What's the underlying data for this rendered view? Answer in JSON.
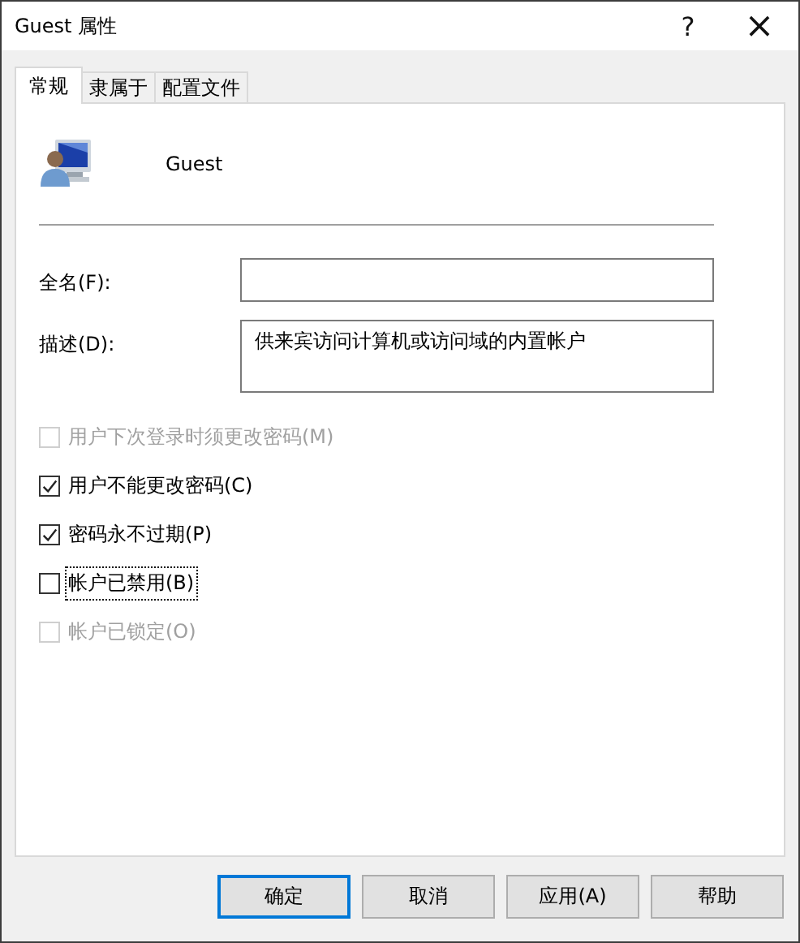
{
  "window": {
    "title": "Guest 属性",
    "help": "?",
    "close": "×"
  },
  "tabs": [
    {
      "label": "常规",
      "selected": true
    },
    {
      "label": "隶属于",
      "selected": false
    },
    {
      "label": "配置文件",
      "selected": false
    }
  ],
  "user": {
    "name": "Guest"
  },
  "fields": [
    {
      "label": "全名(F):",
      "kind": "line"
    },
    {
      "label": "描述(D):",
      "value": "供来宾访问计算机或访问域的内置帐户",
      "kind": "area"
    }
  ],
  "options": [
    {
      "label": "用户下次登录时须更改密码(M)",
      "checked": false,
      "disabled": true,
      "focused": false
    },
    {
      "label": "用户不能更改密码(C)",
      "checked": true,
      "disabled": false,
      "focused": false
    },
    {
      "label": "密码永不过期(P)",
      "checked": true,
      "disabled": false,
      "focused": false
    },
    {
      "label": "帐户已禁用(B)",
      "checked": false,
      "disabled": false,
      "focused": true
    },
    {
      "label": "帐户已锁定(O)",
      "checked": false,
      "disabled": true,
      "focused": false
    }
  ],
  "buttons": [
    {
      "label": "确定",
      "default": true
    },
    {
      "label": "取消",
      "default": false
    },
    {
      "label": "应用(A)",
      "default": false
    },
    {
      "label": "帮助",
      "default": false
    }
  ]
}
